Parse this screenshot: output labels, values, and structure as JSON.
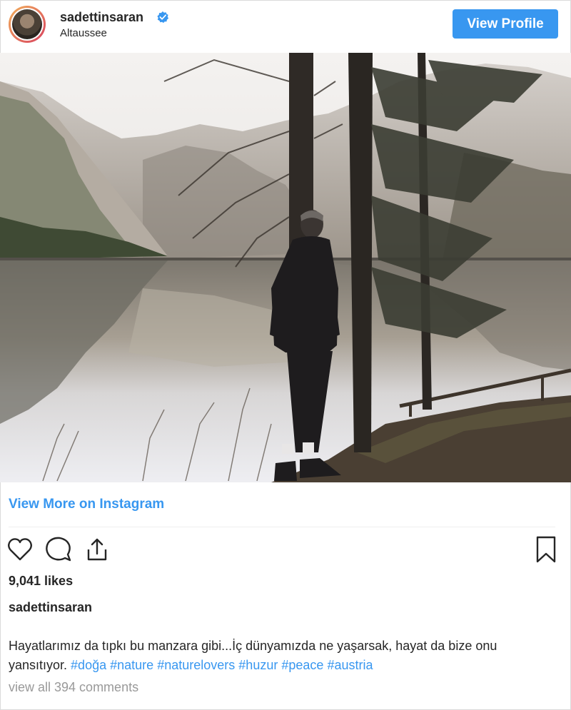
{
  "header": {
    "username": "sadettinsaran",
    "location": "Altaussee",
    "view_profile_label": "View Profile",
    "verified_icon": "verified-badge-icon"
  },
  "post": {
    "image_alt": "Man standing between trees by a mountain lake"
  },
  "footer": {
    "view_more_label": "View More on Instagram",
    "likes": "9,041 likes",
    "caption_user": "sadettinsaran",
    "caption_text": "Hayatlarımız da tıpkı bu manzara gibi...İç dünyamızda ne yaşarsak, hayat da bize onu yansıtıyor. ",
    "hashtags": [
      "#doğa",
      "#nature",
      "#naturelovers",
      "#huzur",
      "#peace",
      "#austria"
    ],
    "comments_label": "view all 394 comments"
  },
  "icons": {
    "like": "heart-icon",
    "comment": "comment-bubble-icon",
    "share": "share-icon",
    "save": "bookmark-icon"
  },
  "colors": {
    "accent": "#3897f0",
    "text": "#262626",
    "muted": "#999999",
    "border": "#dbdbdb"
  }
}
